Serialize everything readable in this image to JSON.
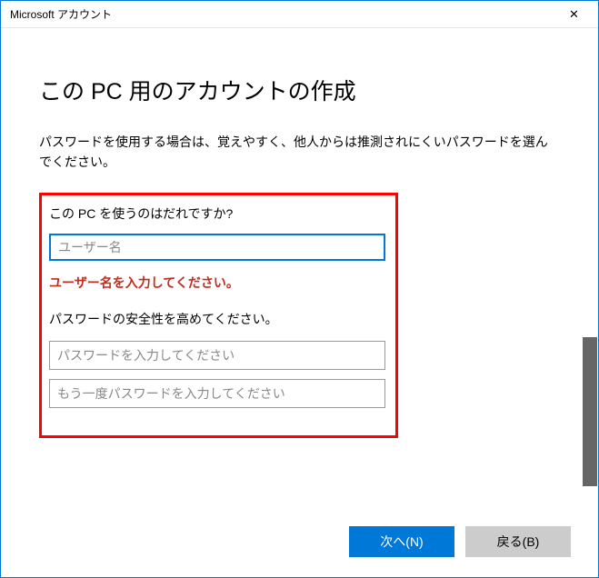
{
  "window": {
    "title": "Microsoft アカウント"
  },
  "page": {
    "heading": "この PC 用のアカウントの作成",
    "description": "パスワードを使用する場合は、覚えやすく、他人からは推測されにくいパスワードを選んでください。"
  },
  "form": {
    "who_label": "この PC を使うのはだれですか?",
    "username_placeholder": "ユーザー名",
    "username_value": "",
    "error_message": "ユーザー名を入力してください。",
    "password_section_label": "パスワードの安全性を高めてください。",
    "password_placeholder": "パスワードを入力してください",
    "password_confirm_placeholder": "もう一度パスワードを入力してください"
  },
  "buttons": {
    "next": "次へ(N)",
    "back": "戻る(B)"
  }
}
